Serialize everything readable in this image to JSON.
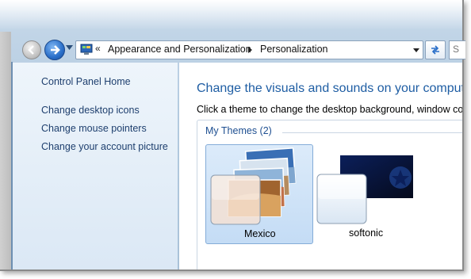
{
  "nav": {
    "back_icon": "back-arrow-icon",
    "forward_icon": "forward-arrow-icon"
  },
  "address_bar": {
    "prefix": "«",
    "breadcrumbs": [
      "Appearance and Personalization",
      "Personalization"
    ]
  },
  "search": {
    "visible_text": "S"
  },
  "sidebar": {
    "home_link": "Control Panel Home",
    "links": [
      "Change desktop icons",
      "Change mouse pointers",
      "Change your account picture"
    ]
  },
  "main": {
    "title": "Change the visuals and sounds on your comput",
    "subtitle": "Click a theme to change the desktop background, window colo",
    "group_header": "My Themes (2)",
    "themes": [
      {
        "name": "Mexico",
        "selected": true
      },
      {
        "name": "softonic",
        "selected": false
      }
    ]
  },
  "colors": {
    "link": "#1e3f6e",
    "title": "#1e5da3",
    "selection": "#c4dcf5"
  }
}
